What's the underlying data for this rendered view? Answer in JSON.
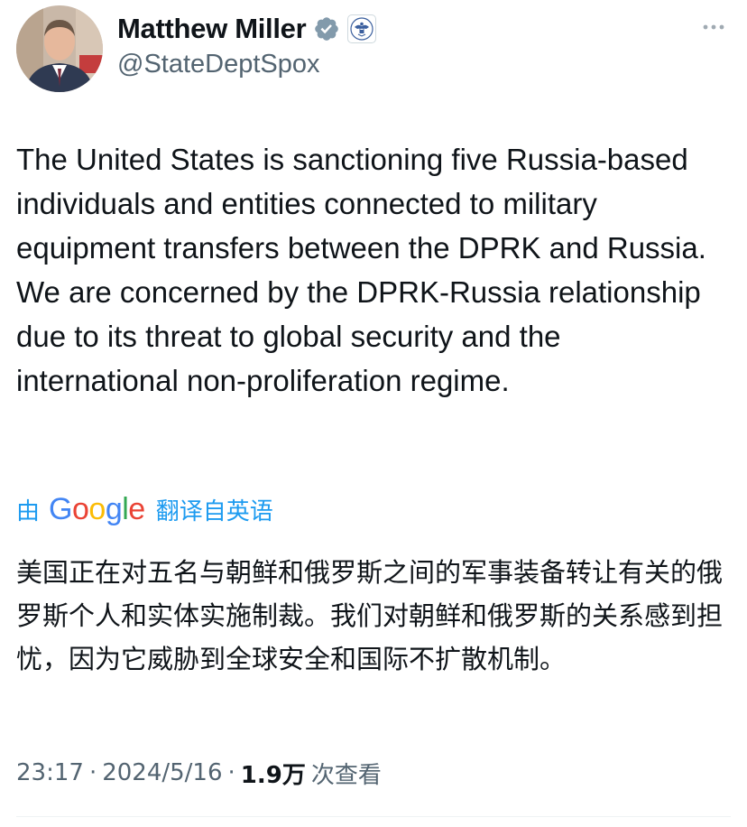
{
  "author": {
    "display_name": "Matthew Miller",
    "handle": "@StateDeptSpox",
    "verified_badge_color": "#829aab"
  },
  "icons": {
    "verified": "verified-badge-icon",
    "affiliation": "us-state-department-seal-icon",
    "more": "more-options-icon"
  },
  "tweet": {
    "text": "The United States is sanctioning five Russia-based individuals and entities connected to military equipment transfers between the DPRK and Russia. We are concerned by the DPRK-Russia relationship due to its threat to global security and the international non-proliferation regime."
  },
  "translation": {
    "by_label": "由",
    "provider": "Google",
    "label": "翻译自英语",
    "text": "美国正在对五名与朝鲜和俄罗斯之间的军事装备转让有关的俄罗斯个人和实体实施制裁。我们对朝鲜和俄罗斯的关系感到担忧，因为它威胁到全球安全和国际不扩散机制。",
    "link_color": "#1d9bf0"
  },
  "meta": {
    "time": "23:17",
    "date": "2024/5/16",
    "views_count": "1.9万",
    "views_label": "次查看"
  }
}
